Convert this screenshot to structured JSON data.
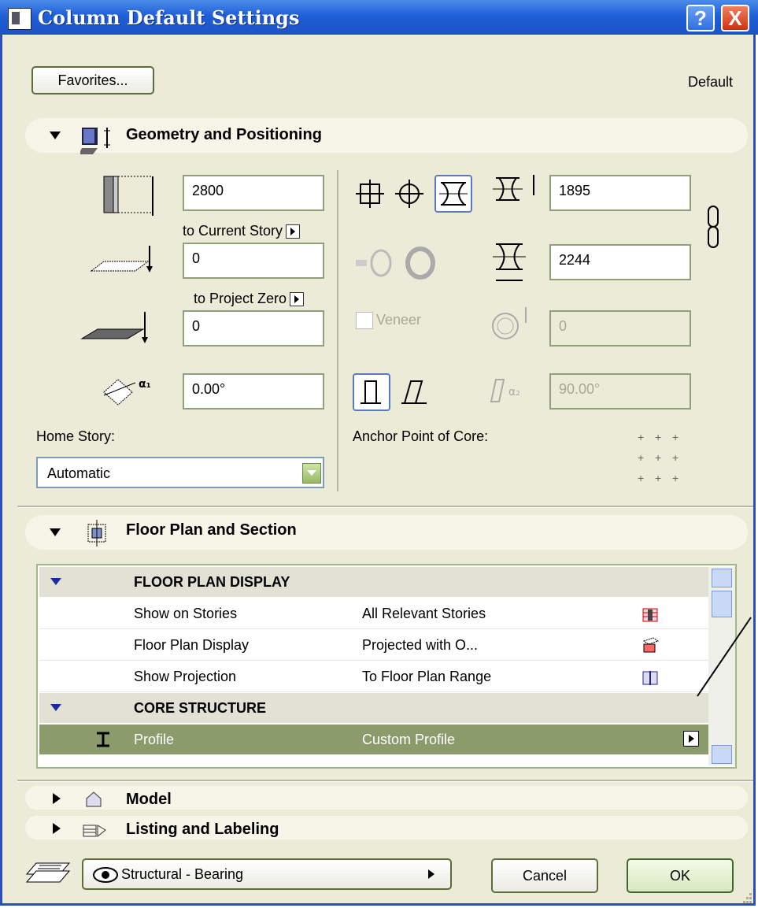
{
  "window": {
    "title": "Column Default Settings",
    "help": "?",
    "close": "X"
  },
  "toolbar": {
    "favorites_label": "Favorites...",
    "default_label": "Default"
  },
  "geometry": {
    "section_title": "Geometry and Positioning",
    "height_value": "2800",
    "to_current_story": "to Current Story",
    "bottom_offset_value": "0",
    "to_project_zero": "to Project Zero",
    "zero_offset_value": "0",
    "rotation_value": "0.00°",
    "home_story_label": "Home Story:",
    "home_story_value": "Automatic",
    "width_value": "1895",
    "depth_value": "2244",
    "veneer_label": "Veneer",
    "veneer_value": "0",
    "slant_value": "90.00°",
    "anchor_label": "Anchor Point of Core:"
  },
  "floorplan": {
    "section_title": "Floor Plan and Section",
    "rows": [
      {
        "type": "group",
        "label": "FLOOR PLAN DISPLAY",
        "value": ""
      },
      {
        "type": "item",
        "label": "Show on Stories",
        "value": "All Relevant Stories",
        "icon": "stories-icon"
      },
      {
        "type": "item",
        "label": "Floor Plan Display",
        "value": "Projected with O...",
        "icon": "projection-icon"
      },
      {
        "type": "item",
        "label": "Show Projection",
        "value": "To Floor Plan Range",
        "icon": "range-icon"
      },
      {
        "type": "group",
        "label": "CORE STRUCTURE",
        "value": ""
      },
      {
        "type": "selected",
        "label": "Profile",
        "value": "Custom Profile",
        "icon": "profile-icon"
      }
    ]
  },
  "sections": {
    "model": "Model",
    "listing": "Listing and Labeling"
  },
  "footer": {
    "layer_value": "Structural - Bearing",
    "cancel_label": "Cancel",
    "ok_label": "OK"
  }
}
